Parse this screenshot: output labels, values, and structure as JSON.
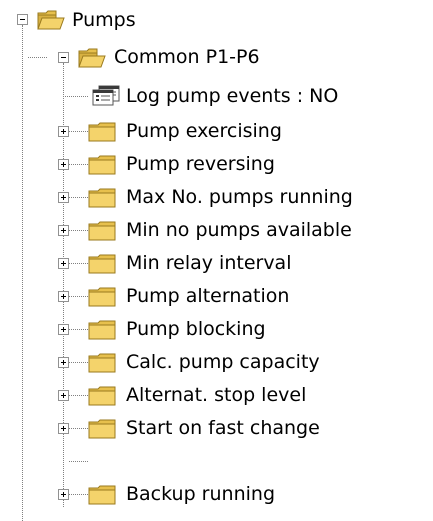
{
  "tree": {
    "root": {
      "label": "Pumps",
      "expanded": true,
      "icon": "folder-open-icon"
    },
    "group": {
      "label": "Common P1-P6",
      "expanded": true,
      "icon": "folder-open-icon"
    },
    "setting": {
      "label": "Log pump events : NO",
      "icon": "parameter-list-icon"
    },
    "items": [
      {
        "label": "Pump exercising",
        "icon": "folder-closed-icon"
      },
      {
        "label": "Pump reversing",
        "icon": "folder-closed-icon"
      },
      {
        "label": "Max No. pumps running",
        "icon": "folder-closed-icon"
      },
      {
        "label": "Min no pumps available",
        "icon": "folder-closed-icon"
      },
      {
        "label": "Min relay interval",
        "icon": "folder-closed-icon"
      },
      {
        "label": "Pump alternation",
        "icon": "folder-closed-icon"
      },
      {
        "label": "Pump blocking",
        "icon": "folder-closed-icon"
      },
      {
        "label": "Calc. pump capacity",
        "icon": "folder-closed-icon"
      },
      {
        "label": "Alternat. stop level",
        "icon": "folder-closed-icon"
      },
      {
        "label": "Start on fast change",
        "icon": "folder-closed-icon"
      },
      {
        "label": "Backup running",
        "icon": "folder-closed-icon"
      }
    ],
    "colors": {
      "folder_fill": "#f4d36b",
      "folder_tab": "#e7c04d",
      "folder_edge": "#9a7a1e",
      "line": "#808080"
    }
  }
}
